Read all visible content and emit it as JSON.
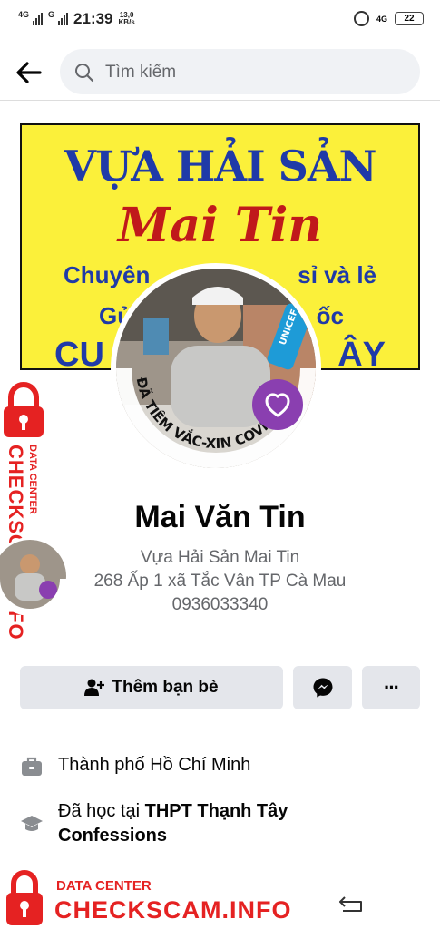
{
  "status_bar": {
    "signal1": "4G",
    "signal2": "G",
    "time": "21:39",
    "speed_value": "13,0",
    "speed_unit": "KB/s",
    "network": "4G",
    "battery": "22"
  },
  "search": {
    "placeholder": "Tìm kiếm"
  },
  "cover": {
    "line1": "VỰA HẢI SẢN",
    "line2": "Mai Tin",
    "line3_left": "Chuyên",
    "line3_right": "sỉ và lẻ",
    "line4_left": "Gử",
    "line4_right": "ốc",
    "line5_left": "CU",
    "line5_right": "ÂY"
  },
  "avatar_frame": {
    "ring_text": "ĐÃ TIÊM VẮC-XIN COVID-19",
    "badge_text": "UNICEF"
  },
  "profile": {
    "name": "Mai Văn Tin",
    "bio_line1": "Vựa Hải Sản Mai Tin",
    "bio_line2": "268 Ấp 1 xã Tắc Vân TP Cà Mau",
    "bio_line3": "0936033340"
  },
  "actions": {
    "add_friend": "Thêm bạn bè",
    "more": "···"
  },
  "info": {
    "work_text": "Thành phố Hồ Chí Minh",
    "study_prefix": "Đã học tại ",
    "study_school_line1": "THPT Thạnh Tây",
    "study_school_line2": "Confessions"
  },
  "watermark": {
    "small": "DATA CENTER",
    "brand": "CHECKSCAM.INFO",
    "color": "#e52222"
  },
  "icons": [
    "back-arrow-icon",
    "search-icon",
    "add-person-icon",
    "messenger-icon",
    "more-icon",
    "briefcase-icon",
    "graduation-cap-icon",
    "lock-icon",
    "back-nav-icon"
  ]
}
